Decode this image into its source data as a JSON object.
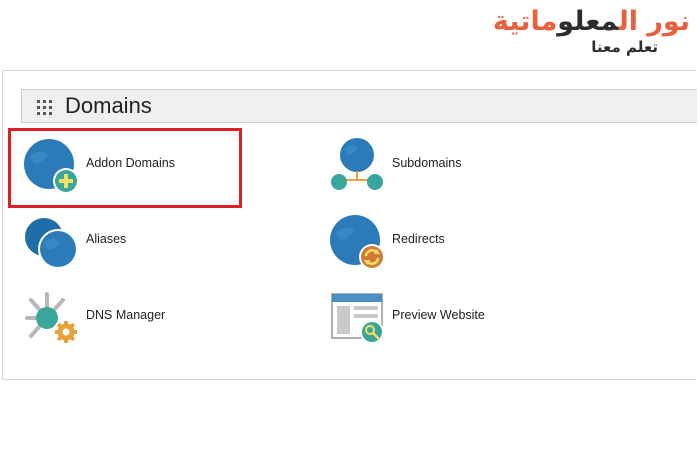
{
  "logo": {
    "title_part1": "نور ال",
    "title_part2": "معلو",
    "title_part3": "ماتية",
    "tagline": "تعلم معنا"
  },
  "section": {
    "title": "Domains"
  },
  "items": [
    {
      "label": "Addon Domains",
      "icon": "globe-add-icon"
    },
    {
      "label": "Subdomains",
      "icon": "subdomains-icon"
    },
    {
      "label": "Aliases",
      "icon": "aliases-icon"
    },
    {
      "label": "Redirects",
      "icon": "redirects-icon"
    },
    {
      "label": "DNS Manager",
      "icon": "dns-manager-icon"
    },
    {
      "label": "Preview Website",
      "icon": "preview-website-icon"
    }
  ],
  "colors": {
    "globe": "#2b7bb9",
    "badge_teal": "#3aa59b",
    "badge_orange": "#e9a23b",
    "highlight": "#e01c24",
    "logo_orange": "#e8603c"
  }
}
